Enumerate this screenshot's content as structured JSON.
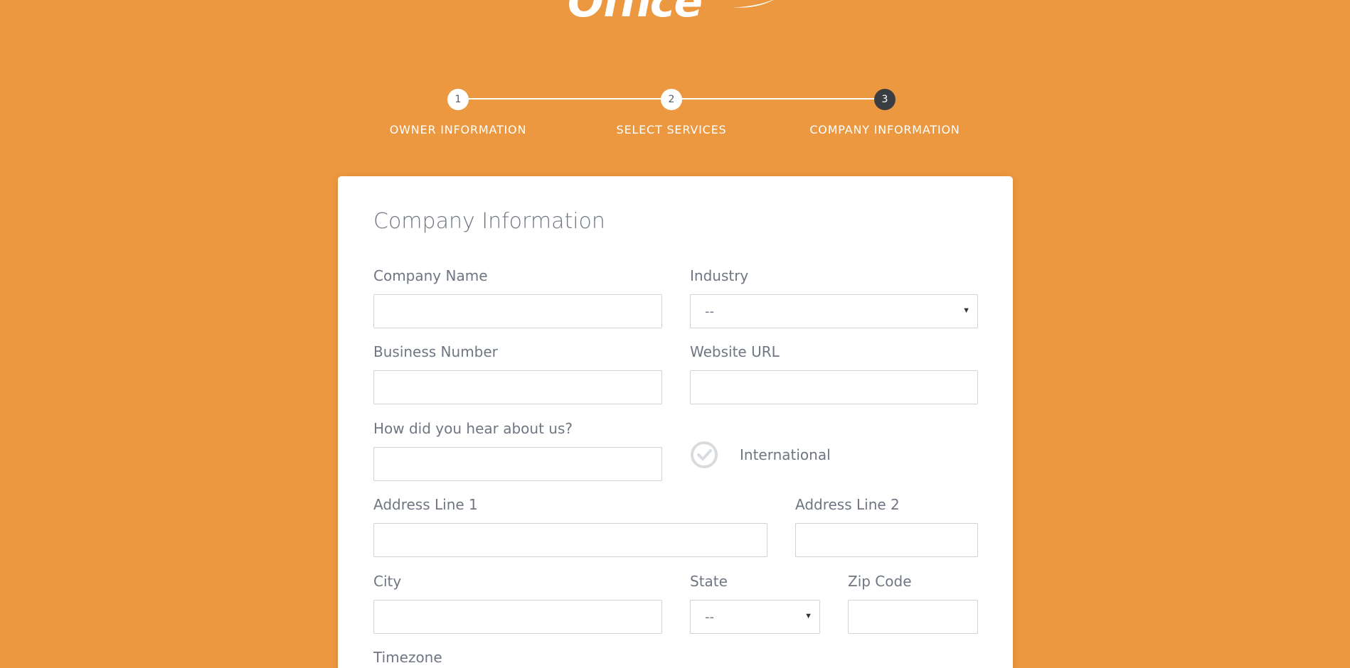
{
  "brand": {
    "logo_text": "Office",
    "background_color": "#ec9840",
    "active_step_color": "#3a3d42"
  },
  "stepper": {
    "steps": [
      {
        "number": "1",
        "label": "OWNER INFORMATION",
        "state": "completed"
      },
      {
        "number": "2",
        "label": "SELECT SERVICES",
        "state": "completed"
      },
      {
        "number": "3",
        "label": "COMPANY INFORMATION",
        "state": "active"
      }
    ]
  },
  "form": {
    "title": "Company Information",
    "company_name": {
      "label": "Company Name",
      "value": ""
    },
    "industry": {
      "label": "Industry",
      "selected": "--"
    },
    "business_number": {
      "label": "Business Number",
      "value": ""
    },
    "website_url": {
      "label": "Website URL",
      "value": ""
    },
    "referral": {
      "label": "How did you hear about us?",
      "value": ""
    },
    "international": {
      "label": "International",
      "checked": false
    },
    "address_line_1": {
      "label": "Address Line 1",
      "value": ""
    },
    "address_line_2": {
      "label": "Address Line 2",
      "value": ""
    },
    "city": {
      "label": "City",
      "value": ""
    },
    "state": {
      "label": "State",
      "selected": "--"
    },
    "zip_code": {
      "label": "Zip Code",
      "value": ""
    },
    "timezone": {
      "label": "Timezone"
    }
  }
}
